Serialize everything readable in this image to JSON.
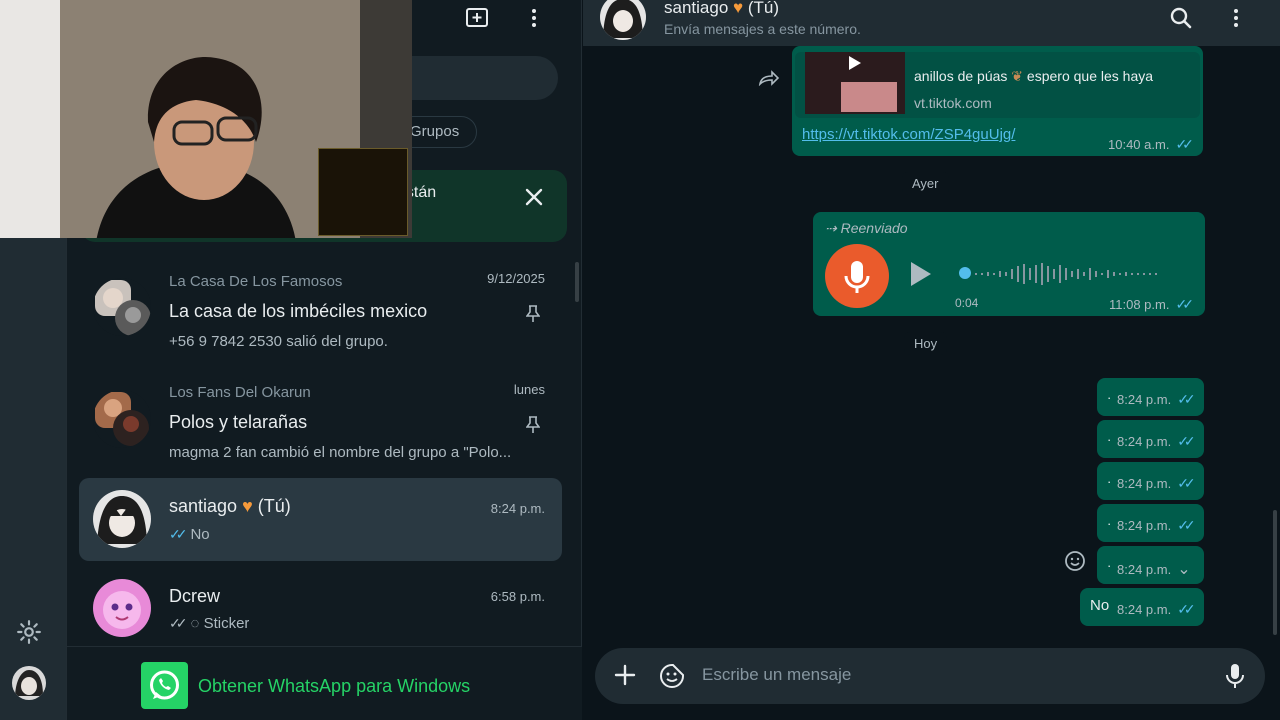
{
  "list": {
    "chip_label": "Grupos",
    "banner_text": "están",
    "chats": [
      {
        "group": "La Casa De Los Famosos",
        "name": "La casa de los imbéciles mexico",
        "preview": "+56 9 7842 2530 salió del grupo.",
        "time": "9/12/2025",
        "pinned": true
      },
      {
        "group": "Los Fans Del Okarun",
        "name": "Polos y telarañas",
        "preview": "magma 2 fan cambió el nombre del grupo a \"Polo...",
        "time": "lunes",
        "pinned": true
      },
      {
        "name": "santiago",
        "suffix": "(Tú)",
        "preview": "No",
        "time": "8:24 p.m.",
        "ticks": "✓✓"
      },
      {
        "name": "Dcrew",
        "preview": "Sticker",
        "time": "6:58 p.m.",
        "ticks": "✓✓"
      }
    ],
    "footer_text": "Obtener WhatsApp para Windows",
    "avatar_label": "ALMO"
  },
  "conversation": {
    "title": "santiago",
    "title_suffix": "(Tú)",
    "subtitle": "Envía mensajes a este número.",
    "link_message": {
      "title": "anillos de púas",
      "title_tail": "espero que les haya",
      "domain": "vt.tiktok.com",
      "url": "https://vt.tiktok.com/ZSP4guUjg/",
      "time": "10:40 a.m.",
      "ticks": "✓✓"
    },
    "day_yesterday": "Ayer",
    "voice_message": {
      "forwarded_label": "Reenviado",
      "duration": "0:04",
      "time": "11:08 p.m.",
      "ticks": "✓✓"
    },
    "day_today": "Hoy",
    "small_messages": [
      {
        "text": "·",
        "time": "8:24 p.m.",
        "ticks": "✓✓"
      },
      {
        "text": "·",
        "time": "8:24 p.m.",
        "ticks": "✓✓"
      },
      {
        "text": "·",
        "time": "8:24 p.m.",
        "ticks": "✓✓"
      },
      {
        "text": "·",
        "time": "8:24 p.m.",
        "ticks": "✓✓"
      },
      {
        "text": "·",
        "time": "8:24 p.m.",
        "ticks": "⌄"
      },
      {
        "text": "No",
        "time": "8:24 p.m.",
        "ticks": "✓✓"
      }
    ],
    "composer_placeholder": "Escribe un mensaje"
  },
  "colors": {
    "accent": "#25d366",
    "bubble": "#005c4b",
    "tick": "#53bdeb",
    "mic": "#ea5b2c"
  }
}
